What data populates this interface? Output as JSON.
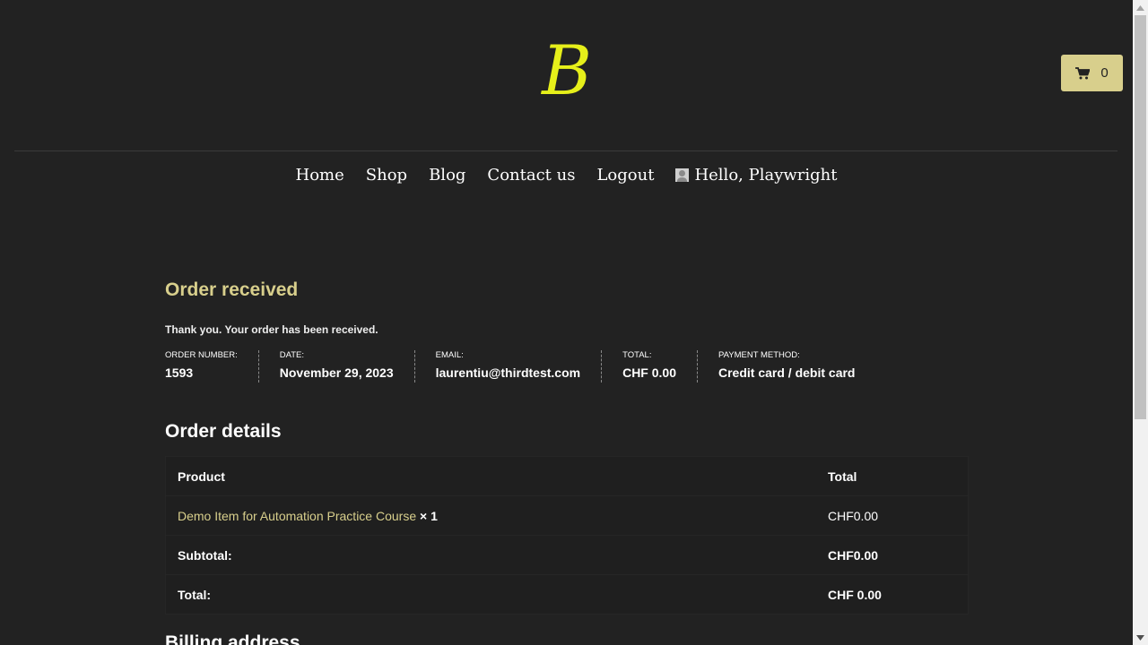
{
  "header": {
    "logo_text": "B",
    "cart_count": "0",
    "colors": {
      "logo": "#e6ef1a",
      "accent": "#d8cf8c",
      "background": "#222222"
    }
  },
  "nav": {
    "items": [
      "Home",
      "Shop",
      "Blog",
      "Contact us",
      "Logout"
    ],
    "user_greeting": "Hello, Playwright"
  },
  "order": {
    "title": "Order received",
    "thank_you": "Thank you. Your order has been received.",
    "overview": [
      {
        "label": "Order number:",
        "value": "1593"
      },
      {
        "label": "Date:",
        "value": "November 29, 2023"
      },
      {
        "label": "Email:",
        "value": "laurentiu@thirdtest.com"
      },
      {
        "label": "Total:",
        "value": "CHF 0.00"
      },
      {
        "label": "Payment method:",
        "value": "Credit card / debit card"
      }
    ]
  },
  "details": {
    "title": "Order details",
    "headers": {
      "product": "Product",
      "total": "Total"
    },
    "item": {
      "name": "Demo Item for Automation Practice Course",
      "qty": "× 1",
      "total": "CHF0.00"
    },
    "subtotal": {
      "label": "Subtotal:",
      "value": "CHF0.00"
    },
    "total": {
      "label": "Total:",
      "value": "CHF 0.00"
    }
  },
  "billing": {
    "title": "Billing address"
  }
}
